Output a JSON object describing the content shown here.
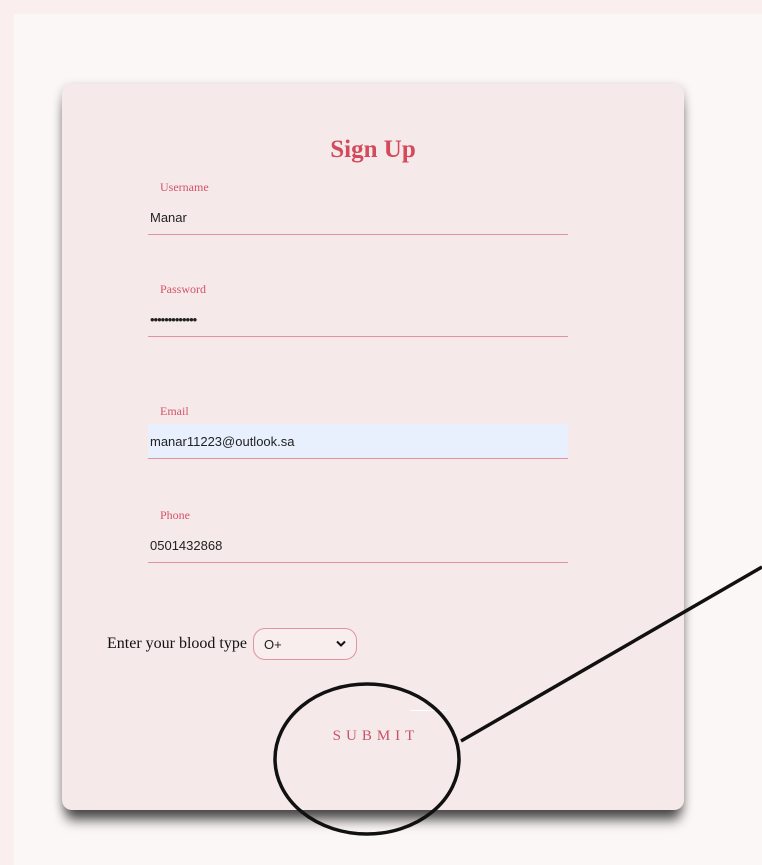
{
  "form": {
    "title": "Sign Up",
    "fields": [
      {
        "label": "Username",
        "value": "Manar",
        "type": "text"
      },
      {
        "label": "Password",
        "value": "•••••••••••••",
        "type": "password"
      },
      {
        "label": "Email",
        "value": "manar11223@outlook.sa",
        "type": "email",
        "autofilled": true
      },
      {
        "label": "Phone",
        "value": "0501432868",
        "type": "tel"
      }
    ],
    "blood_type": {
      "label": "Enter your blood type",
      "selected": "O+"
    },
    "submit_label": "SUBMIT"
  },
  "colors": {
    "accent": "#d24a5b",
    "card_background": "#f5eae9",
    "underline": "#e3939f",
    "autofill_background": "#e8f0fd"
  },
  "icons": {
    "select_chevron": "chevron-down-icon"
  }
}
